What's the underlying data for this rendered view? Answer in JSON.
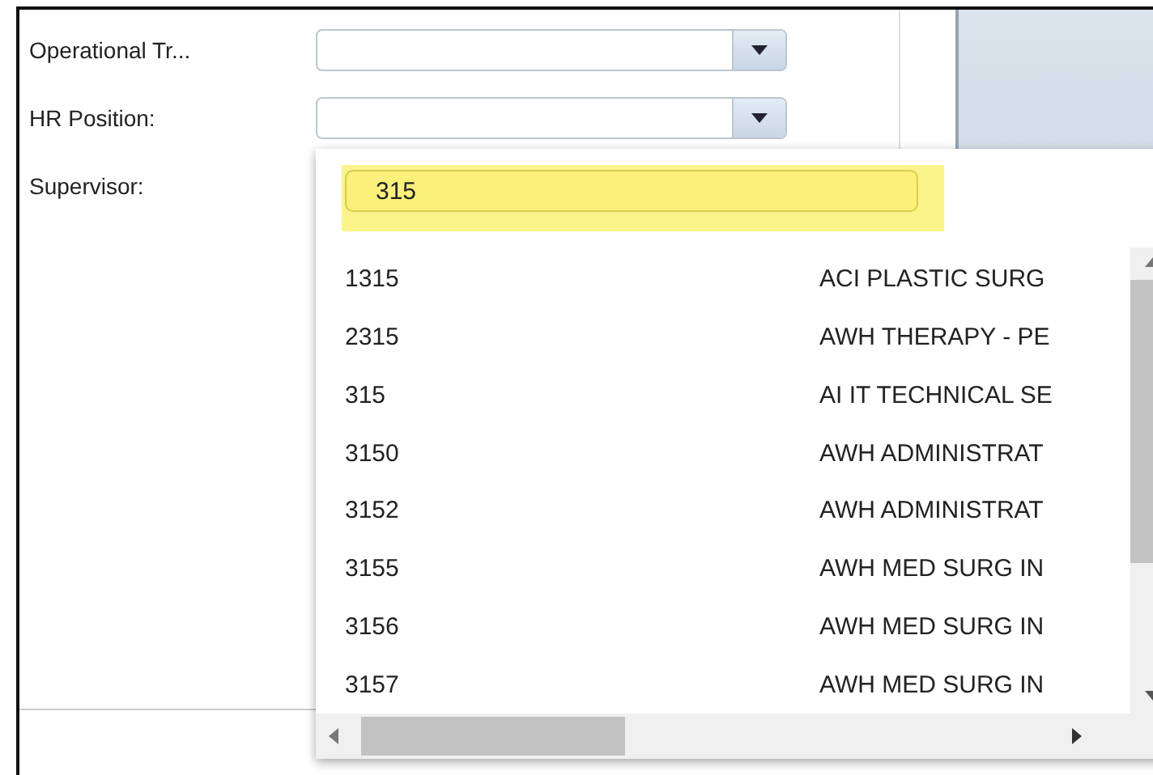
{
  "form": {
    "fields": [
      {
        "label": "Operational Tr...",
        "kind": "combo"
      },
      {
        "label": "HR Position:",
        "kind": "combo"
      },
      {
        "label": "Supervisor:",
        "kind": "none"
      }
    ]
  },
  "dropdown": {
    "search": {
      "value": "315"
    },
    "rows": [
      {
        "code": "1315",
        "name": "ACI PLASTIC SURG"
      },
      {
        "code": "2315",
        "name": "AWH THERAPY - PE"
      },
      {
        "code": "315",
        "name": "AI IT TECHNICAL SE"
      },
      {
        "code": "3150",
        "name": "AWH ADMINISTRAT"
      },
      {
        "code": "3152",
        "name": "AWH ADMINISTRAT"
      },
      {
        "code": "3155",
        "name": "AWH MED SURG IN"
      },
      {
        "code": "3156",
        "name": "AWH MED SURG IN"
      },
      {
        "code": "3157",
        "name": "AWH MED SURG IN"
      }
    ]
  }
}
